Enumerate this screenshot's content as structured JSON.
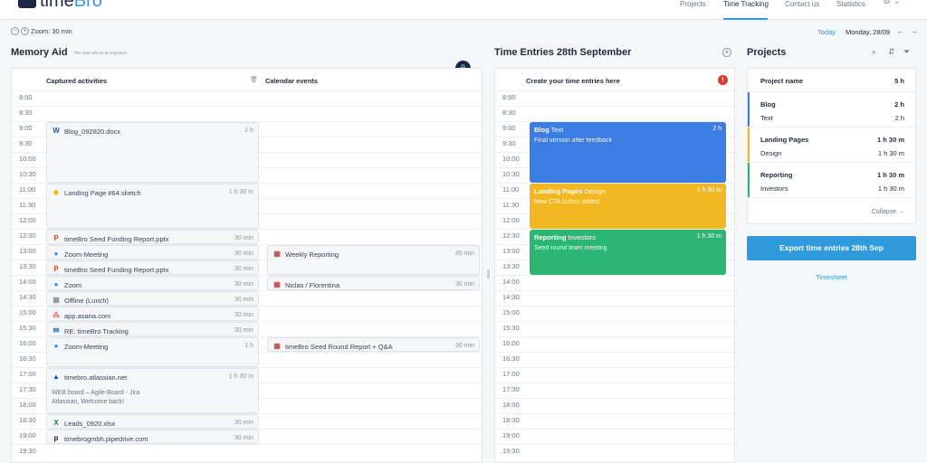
{
  "app": {
    "logo_prefix": "time",
    "logo_suffix": "Bro"
  },
  "nav": [
    "Projects",
    "Time Tracking",
    "Contact us",
    "Statistics"
  ],
  "toolbar": {
    "zoom": "Zoom: 30 min",
    "today": "Today",
    "date": "Monday, 28/09",
    "zoom_out": "−",
    "zoom_in": "+",
    "prev": "←",
    "next": "→"
  },
  "memory": {
    "title": "Memory Aid",
    "note": "This data will not be exported.",
    "col1": "Captured activities",
    "col2": "Calendar events"
  },
  "entries_panel": {
    "title": "Time Entries 28th September",
    "header": "Create your time entries here"
  },
  "times": [
    "8:00",
    "8:30",
    "9:00",
    "9:30",
    "10:00",
    "10:30",
    "11:00",
    "11:30",
    "12:00",
    "12:30",
    "13:00",
    "13:30",
    "14:00",
    "14:30",
    "15:00",
    "15:30",
    "16:00",
    "16:30",
    "17:00",
    "17:30",
    "18:00",
    "18:30",
    "19:00",
    "19:30"
  ],
  "activities": [
    {
      "name": "Blog_092820.docx",
      "dur": "2 h",
      "icon": "W",
      "color": "#2b579a",
      "icon_name": "word-icon"
    },
    {
      "name": "Landing Page #64.sketch",
      "dur": "1 h 30 m",
      "icon": "◆",
      "color": "#f7b500",
      "icon_name": "sketch-icon"
    },
    {
      "name": "timeBro Seed Funding Report.pptx",
      "dur": "30 min",
      "icon": "P",
      "color": "#d24726",
      "icon_name": "powerpoint-icon"
    },
    {
      "name": "Zoom-Meeting",
      "dur": "30 min",
      "icon": "●",
      "color": "#2d8cff",
      "icon_name": "zoom-icon"
    },
    {
      "name": "timeBro Seed Funding Report.pptx",
      "dur": "30 min",
      "icon": "P",
      "color": "#d24726",
      "icon_name": "powerpoint-icon"
    },
    {
      "name": "Zoom",
      "dur": "30 min",
      "icon": "●",
      "color": "#2d8cff",
      "icon_name": "zoom-icon"
    },
    {
      "name": "Offline (Lunch)",
      "dur": "30 min",
      "icon": "▦",
      "color": "#8a94a3",
      "icon_name": "calendar-icon"
    },
    {
      "name": "app.asana.com",
      "dur": "30 min",
      "icon": "⁂",
      "color": "#f06a6a",
      "icon_name": "asana-icon"
    },
    {
      "name": "RE: timeBro Tracking",
      "dur": "30 min",
      "icon": "✉",
      "color": "#0072c6",
      "icon_name": "outlook-icon"
    },
    {
      "name": "Zoom-Meeting",
      "dur": "1 h",
      "icon": "●",
      "color": "#2d8cff",
      "icon_name": "zoom-icon"
    },
    {
      "name": "timebro.atlassian.net",
      "dur": "1 h 30 m",
      "sub": "WEB board – Agile-Board - Jira\nAtlassian, Welcome back!",
      "icon": "▲",
      "color": "#0052cc",
      "icon_name": "atlassian-icon"
    },
    {
      "name": "Leads_0920.xlsx",
      "dur": "30 min",
      "icon": "X",
      "color": "#217346",
      "icon_name": "excel-icon"
    },
    {
      "name": "timebrogmbh.pipedrive.com",
      "dur": "30 min",
      "icon": "p",
      "color": "#1a1a1a",
      "icon_name": "pipedrive-icon"
    }
  ],
  "calendar": [
    {
      "name": "Weekly Reporting",
      "dur": "45 min"
    },
    {
      "name": "Niclas / Florentina",
      "dur": "30 min"
    },
    {
      "name": "timeBro Seed Round Report + Q&A",
      "dur": "30 min"
    }
  ],
  "time_entries": [
    {
      "project": "Blog",
      "task": "Text",
      "desc": "Final version after feedback",
      "dur": "2 h",
      "color": "#3b7de0"
    },
    {
      "project": "Landing Pages",
      "task": "Design",
      "desc": "New CTA button added",
      "dur": "1 h 30 m",
      "color": "#f2b824"
    },
    {
      "project": "Reporting",
      "task": "Investors",
      "desc": "Seed round team meeting",
      "dur": "1 h 30 m",
      "color": "#2bb673"
    }
  ],
  "projects": {
    "title": "Projects",
    "header": "Project name",
    "total": "5 h",
    "collapse": "Collapse →",
    "groups": [
      {
        "name": "Blog",
        "dur": "2 h",
        "task": "Text",
        "task_dur": "2 h",
        "color": "#3b7de0"
      },
      {
        "name": "Landing Pages",
        "dur": "1 h 30 m",
        "task": "Design",
        "task_dur": "1 h 30 m",
        "color": "#f2b824"
      },
      {
        "name": "Reporting",
        "dur": "1 h 30 m",
        "task": "Investors",
        "task_dur": "1 h 30 m",
        "color": "#2bb673"
      }
    ]
  },
  "actions": {
    "export": "Export time entries 28th Sep",
    "timesheet": "Timesheet"
  }
}
